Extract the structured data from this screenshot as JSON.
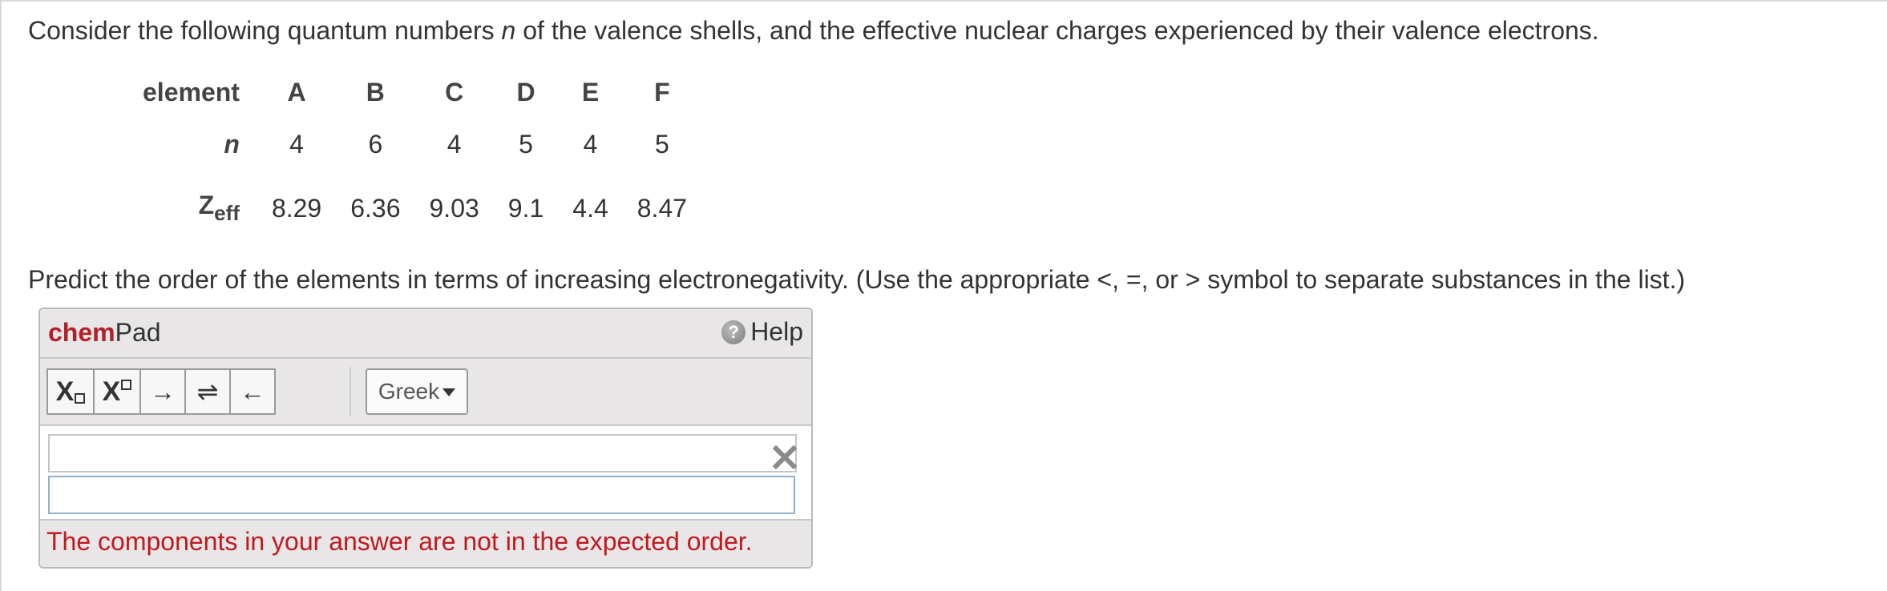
{
  "question": {
    "prefix": "Consider the following quantum numbers ",
    "var": "n",
    "suffix": " of the valence shells, and the effective nuclear charges experienced by their valence electrons."
  },
  "table": {
    "header_label": "element",
    "elements": [
      "A",
      "B",
      "C",
      "D",
      "E",
      "F"
    ],
    "n_label": "n",
    "n_values": [
      "4",
      "6",
      "4",
      "5",
      "4",
      "5"
    ],
    "zeff_label_main": "Z",
    "zeff_label_sub": "eff",
    "zeff_values": [
      "8.29",
      "6.36",
      "9.03",
      "9.1",
      "4.4",
      "8.47"
    ]
  },
  "instruction": "Predict the order of the elements in terms of increasing electronegativity. (Use the appropriate <, =, or > symbol to separate substances in the list.)",
  "chempad": {
    "brand": "chem",
    "name": "Pad",
    "help_label": "Help",
    "help_icon": "question-icon",
    "toolbar": {
      "subscript": "X",
      "superscript": "X",
      "arrow_right": "→",
      "arrow_equilibrium": "⇌",
      "arrow_left": "←",
      "greek_label": "Greek"
    },
    "answer_value": "",
    "error_message": "The components in your answer are not in the expected order."
  },
  "colors": {
    "brand_red": "#b3202a",
    "error_red": "#c0191f",
    "panel_gray": "#e8e6e6",
    "input_border": "#8fb0cc"
  }
}
